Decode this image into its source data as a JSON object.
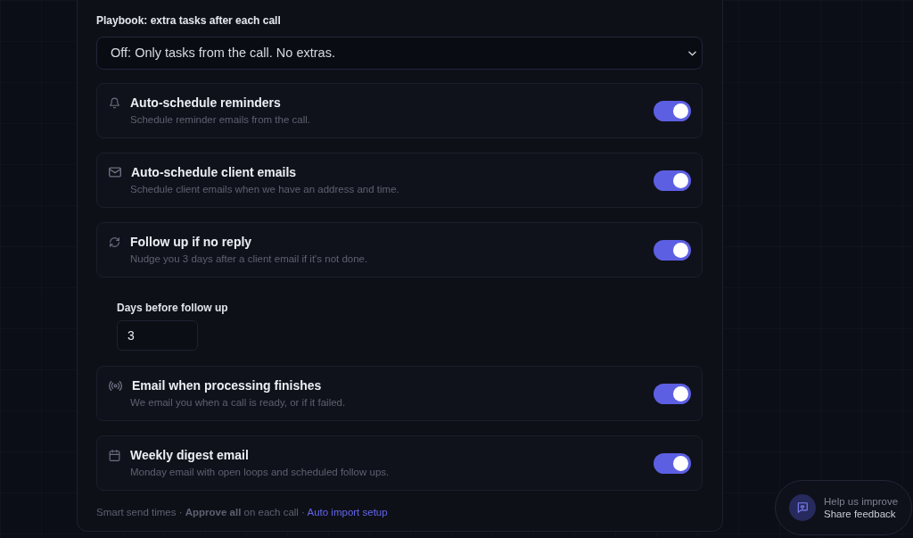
{
  "playbook": {
    "label": "Playbook: extra tasks after each call",
    "select": {
      "value": "Off: Only tasks from the call. No extras."
    }
  },
  "settings": [
    {
      "kind": "toggle",
      "title": "Auto-schedule reminders",
      "description": "Schedule reminder emails from the call.",
      "on": true
    },
    {
      "kind": "toggle",
      "title": "Auto-schedule client emails",
      "description": "Schedule client emails when we have an address and time.",
      "on": true
    },
    {
      "kind": "toggle",
      "title": "Follow up if no reply",
      "description": "Nudge you 3 days after a client email if it's not done.",
      "on": true
    },
    {
      "kind": "field",
      "label": "Days before follow up",
      "value": "3"
    },
    {
      "kind": "toggle",
      "title": "Email when processing finishes",
      "description": "We email you when a call is ready, or if it failed.",
      "on": true
    },
    {
      "kind": "toggle",
      "title": "Weekly digest email",
      "description": "Monday email with open loops and scheduled follow ups.",
      "on": true
    }
  ],
  "footer": {
    "text": "Smart send times · **Approve all** on each call ·",
    "link": "Auto import setup"
  },
  "feedback": {
    "title": "Help us improve",
    "subtitle": "Share feedback"
  }
}
